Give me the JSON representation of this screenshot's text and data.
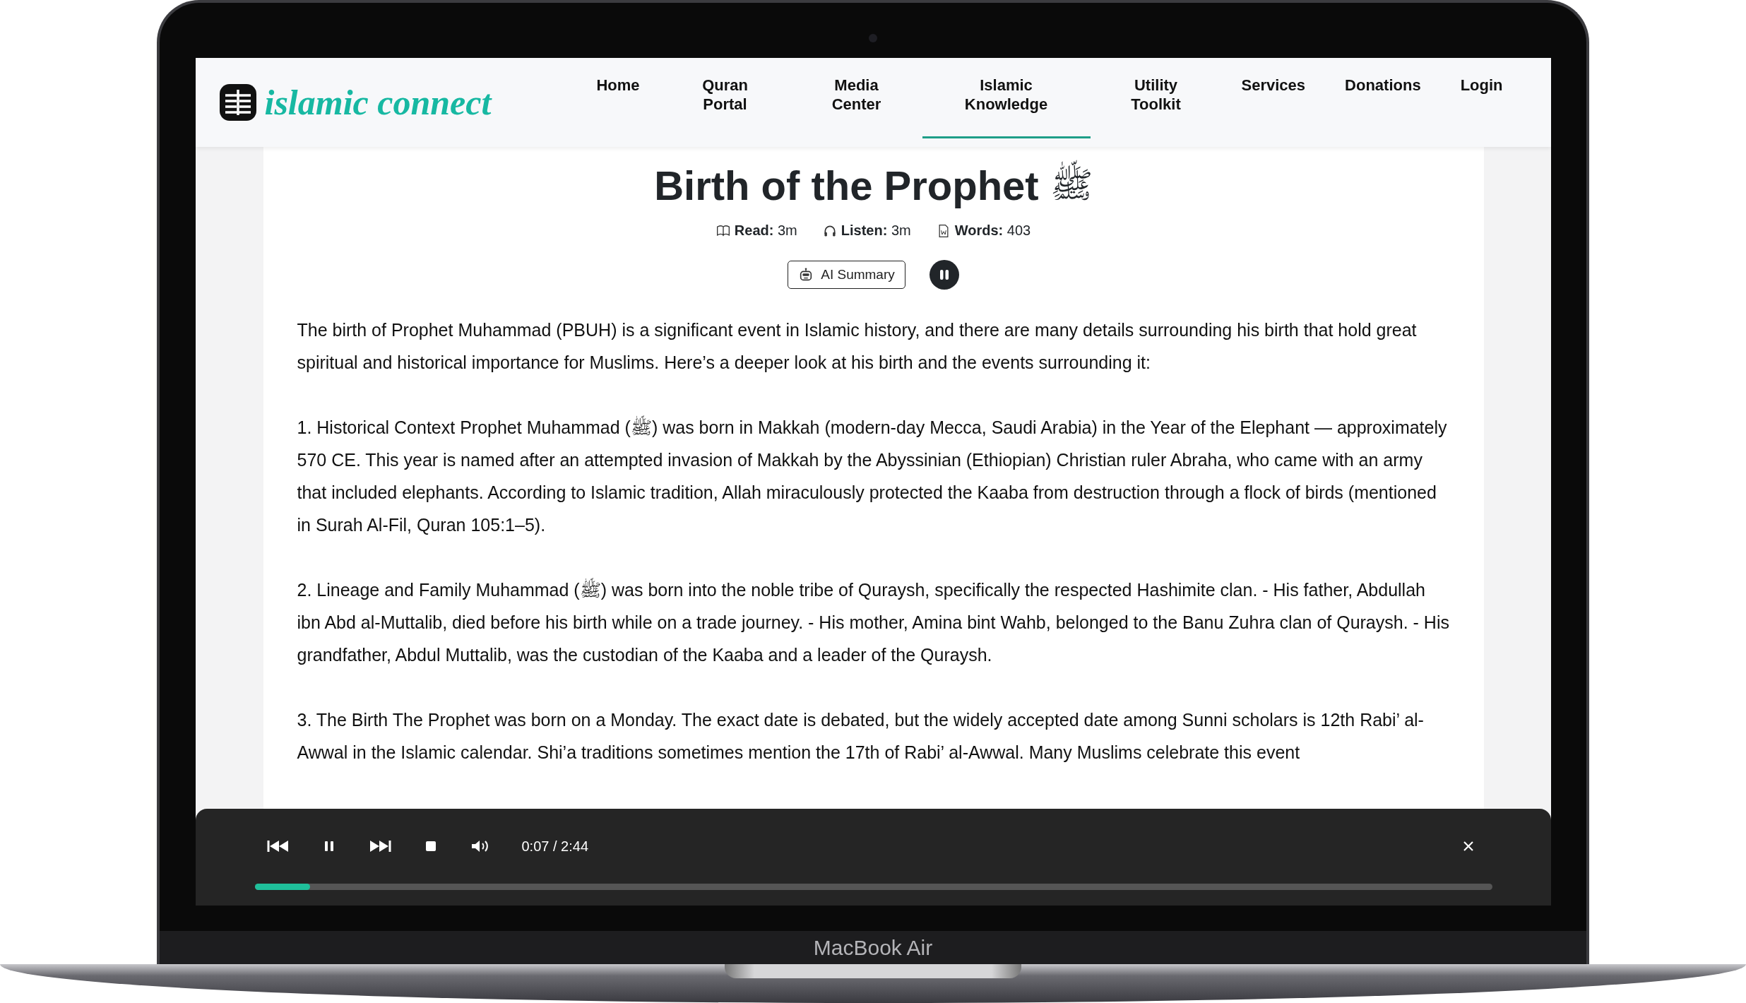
{
  "device": {
    "label": "MacBook Air"
  },
  "header": {
    "logo": "islamic connect",
    "nav": [
      {
        "label": "Home",
        "selected": false
      },
      {
        "label": "Quran Portal",
        "selected": false
      },
      {
        "label": "Media Center",
        "selected": false
      },
      {
        "label": "Islamic Knowledge",
        "selected": true
      },
      {
        "label": "Utility Toolkit",
        "selected": false
      },
      {
        "label": "Services",
        "selected": false
      },
      {
        "label": "Donations",
        "selected": false
      },
      {
        "label": "Login",
        "selected": false
      }
    ]
  },
  "article": {
    "title": "Birth of the Prophet",
    "honorific": "ﷺ",
    "meta": [
      {
        "kind": "read",
        "text": "**Read:** 3m"
      },
      {
        "kind": "listen",
        "text": "**Listen:** 3m"
      },
      {
        "kind": "words",
        "text": "**Words:** 403"
      }
    ],
    "ai_button": "AI Summary",
    "playing": true,
    "paragraphs": [
      "The birth of Prophet Muhammad (PBUH) is a significant event in Islamic history, and there are many details surrounding his birth that hold great spiritual and historical importance for Muslims. Here’s a deeper look at his birth and the events surrounding it:",
      "1. Historical Context Prophet Muhammad (ﷺ) was born in Makkah (modern-day Mecca, Saudi Arabia) in the Year of the Elephant — approximately 570 CE. This year is named after an attempted invasion of Makkah by the Abyssinian (Ethiopian) Christian ruler Abraha, who came with an army that included elephants. According to Islamic tradition, Allah miraculously protected the Kaaba from destruction through a flock of birds (mentioned in Surah Al-Fil, Quran 105:1–5).",
      "2. Lineage and Family Muhammad (ﷺ) was born into the noble tribe of Quraysh, specifically the respected Hashimite clan. - His father, Abdullah ibn Abd al-Muttalib, died before his birth while on a trade journey. - His mother, Amina bint Wahb, belonged to the Banu Zuhra clan of Quraysh. - His grandfather, Abdul Muttalib, was the custodian of the Kaaba and a leader of the Quraysh.",
      "3. The Birth The Prophet was born on a Monday. The exact date is debated, but the widely accepted date among Sunni scholars is 12th Rabi’ al-Awwal in the Islamic calendar. Shi’a traditions sometimes mention the 17th of Rabi’ al-Awwal. Many Muslims celebrate this event"
    ]
  },
  "player": {
    "playing": true,
    "time": "0:07 / 2:44",
    "level": 0.045
  }
}
